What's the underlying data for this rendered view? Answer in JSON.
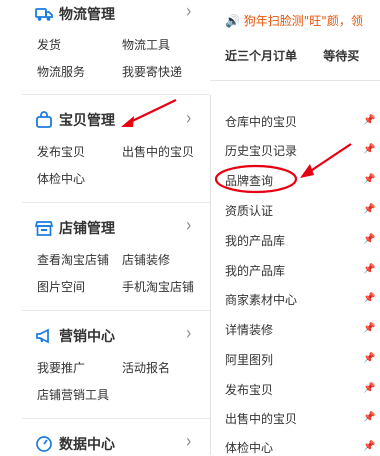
{
  "sidebar": {
    "sections": [
      {
        "title": "物流管理",
        "icon": "truck-icon",
        "links": [
          "发货",
          "物流工具",
          "物流服务",
          "我要寄快递"
        ]
      },
      {
        "title": "宝贝管理",
        "icon": "shopping-bag-icon",
        "links": [
          "发布宝贝",
          "出售中的宝贝",
          "体检中心"
        ]
      },
      {
        "title": "店铺管理",
        "icon": "store-icon",
        "links": [
          "查看淘宝店铺",
          "店铺装修",
          "图片空间",
          "手机淘宝店铺"
        ]
      },
      {
        "title": "营销中心",
        "icon": "megaphone-icon",
        "links": [
          "我要推广",
          "活动报名",
          "店铺营销工具"
        ]
      },
      {
        "title": "数据中心",
        "icon": "dashboard-icon",
        "links": []
      }
    ]
  },
  "flyout": {
    "items": [
      "仓库中的宝贝",
      "历史宝贝记录",
      "品牌查询",
      "资质认证",
      "我的产品库",
      "我的产品库",
      "商家素材中心",
      "详情装修",
      "阿里图列",
      "发布宝贝",
      "出售中的宝贝",
      "体检中心"
    ]
  },
  "topbar": {
    "notice": "狗年扫脸测\"旺\"颜，领",
    "tabs": [
      "近三个月订单",
      "等待买"
    ]
  },
  "colors": {
    "accent": "#1a7ce0",
    "annotation": "#e60012",
    "notice": "#e8550a"
  }
}
